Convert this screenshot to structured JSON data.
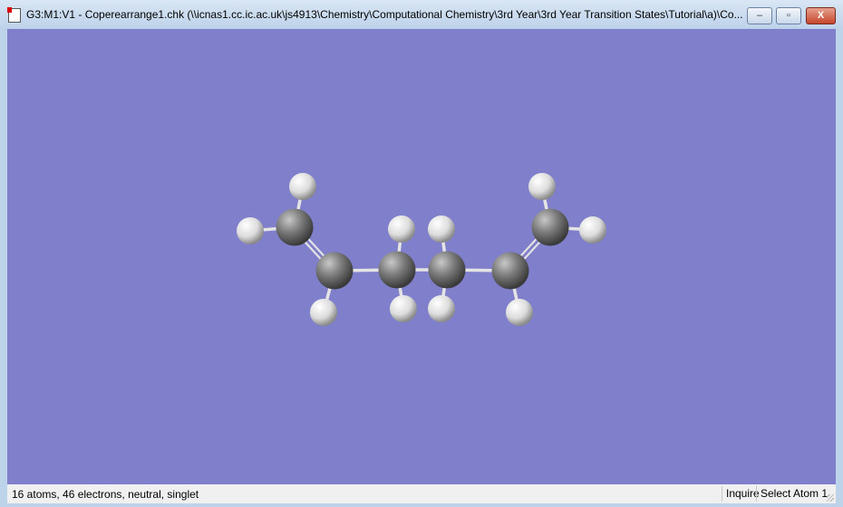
{
  "window": {
    "title": "G3:M1:V1 - Coperearrange1.chk (\\\\icnas1.cc.ic.ac.uk\\js4913\\Chemistry\\Computational Chemistry\\3rd Year\\3rd Year Transition States\\Tutorial\\a)\\Co...",
    "minimize_label": "–",
    "maximize_label": "▫",
    "close_label": "X"
  },
  "viewport": {
    "background": "#7f7fcc"
  },
  "status": {
    "summary": "16 atoms, 46 electrons, neutral, singlet",
    "mode": "Inquire",
    "action": "Select Atom 1"
  }
}
